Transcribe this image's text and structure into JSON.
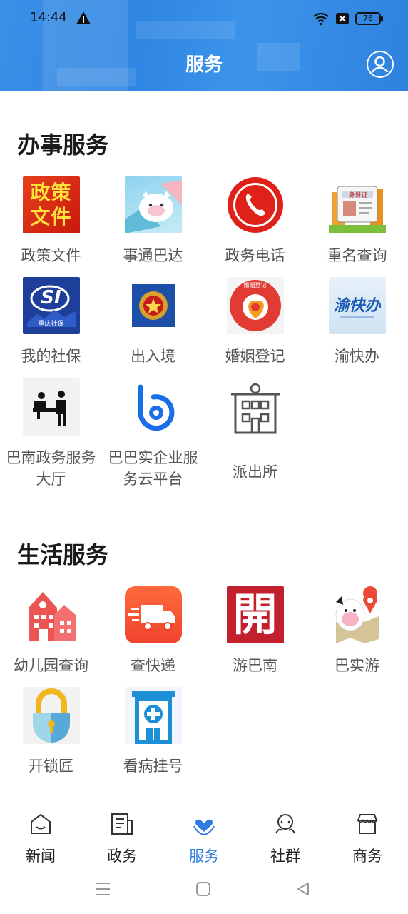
{
  "status": {
    "time": "14:44",
    "battery": "76"
  },
  "header": {
    "title": "服务"
  },
  "sections": {
    "work": {
      "title": "办事服务",
      "items": [
        {
          "label": "政策文件",
          "icon": "policy-docs-icon"
        },
        {
          "label": "事通巴达",
          "icon": "shitong-bada-icon"
        },
        {
          "label": "政务电话",
          "icon": "phone-icon"
        },
        {
          "label": "重名查询",
          "icon": "id-card-icon"
        },
        {
          "label": "我的社保",
          "icon": "social-security-icon"
        },
        {
          "label": "出入境",
          "icon": "police-emblem-icon"
        },
        {
          "label": "婚姻登记",
          "icon": "marriage-registration-icon"
        },
        {
          "label": "渝快办",
          "icon": "yukuaiban-icon"
        },
        {
          "label": "巴南政务服务大厅",
          "icon": "service-hall-icon"
        },
        {
          "label": "巴巴实企业服务云平台",
          "icon": "cloud-platform-icon"
        },
        {
          "label": "派出所",
          "icon": "police-station-icon"
        }
      ]
    },
    "life": {
      "title": "生活服务",
      "items": [
        {
          "label": "幼儿园查询",
          "icon": "kindergarten-icon"
        },
        {
          "label": "查快递",
          "icon": "delivery-truck-icon"
        },
        {
          "label": "游巴南",
          "icon": "tour-banan-icon"
        },
        {
          "label": "巴实游",
          "icon": "tour-map-icon"
        },
        {
          "label": "开锁匠",
          "icon": "padlock-icon"
        },
        {
          "label": "看病挂号",
          "icon": "hospital-icon"
        }
      ]
    }
  },
  "icon_text": {
    "policy": "政策文件",
    "si": "SI",
    "si_sub": "重庆社保",
    "yukuai": "渝快办",
    "idcard": "身份证",
    "marriage": "婚姻登记",
    "tour": "開"
  },
  "tabs": [
    {
      "label": "新闻",
      "icon": "news-icon"
    },
    {
      "label": "政务",
      "icon": "gov-doc-icon"
    },
    {
      "label": "服务",
      "icon": "service-heart-icon",
      "active": true
    },
    {
      "label": "社群",
      "icon": "community-icon"
    },
    {
      "label": "商务",
      "icon": "store-icon"
    }
  ],
  "colors": {
    "accent": "#2d7de0",
    "header": "#3a8fe6"
  }
}
